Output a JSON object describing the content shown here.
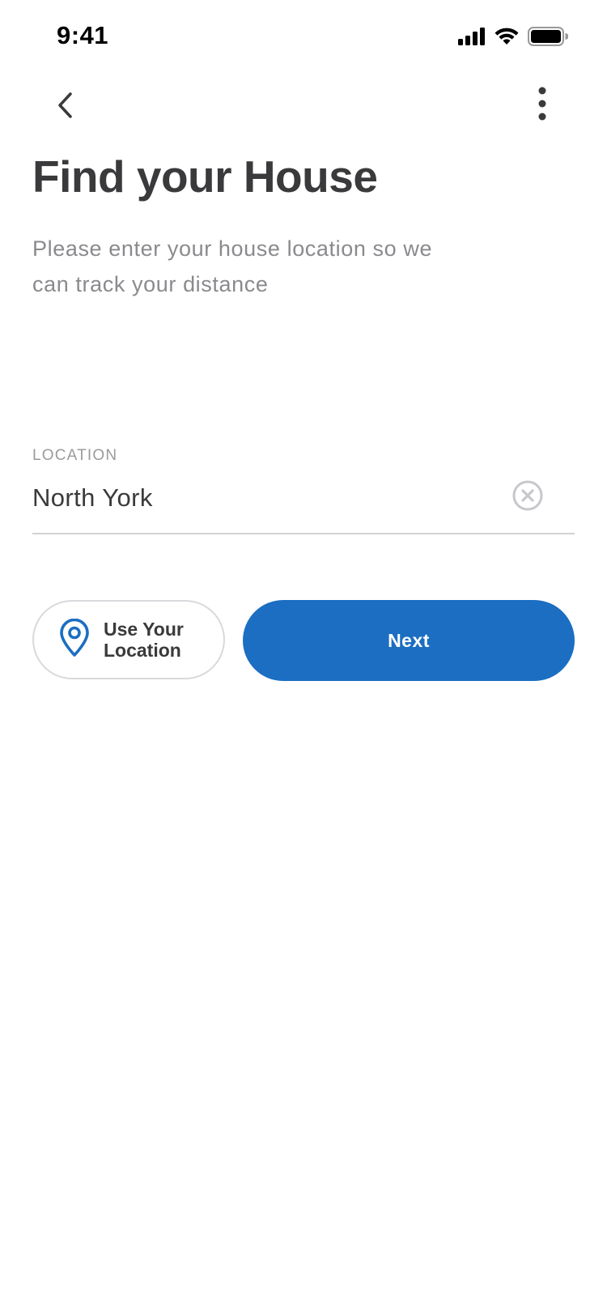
{
  "status_bar": {
    "time": "9:41",
    "icons": [
      "cellular-signal-icon",
      "wifi-icon",
      "battery-icon"
    ]
  },
  "nav": {
    "back_icon": "chevron-left-icon",
    "more_icon": "more-vertical-icon"
  },
  "header": {
    "title": "Find your House",
    "subtitle": "Please enter your house location so we can track your distance"
  },
  "location_field": {
    "label": "LOCATION",
    "value": "North York",
    "clear_icon": "clear-circle-icon"
  },
  "actions": {
    "use_location_label": "Use Your\nLocation",
    "use_location_icon": "location-pin-icon",
    "next_label": "Next"
  },
  "colors": {
    "accent": "#1b6ec2",
    "title_text": "#3a3a3c",
    "subtitle_text": "#8a8a8e",
    "divider": "#d1d1d6"
  }
}
